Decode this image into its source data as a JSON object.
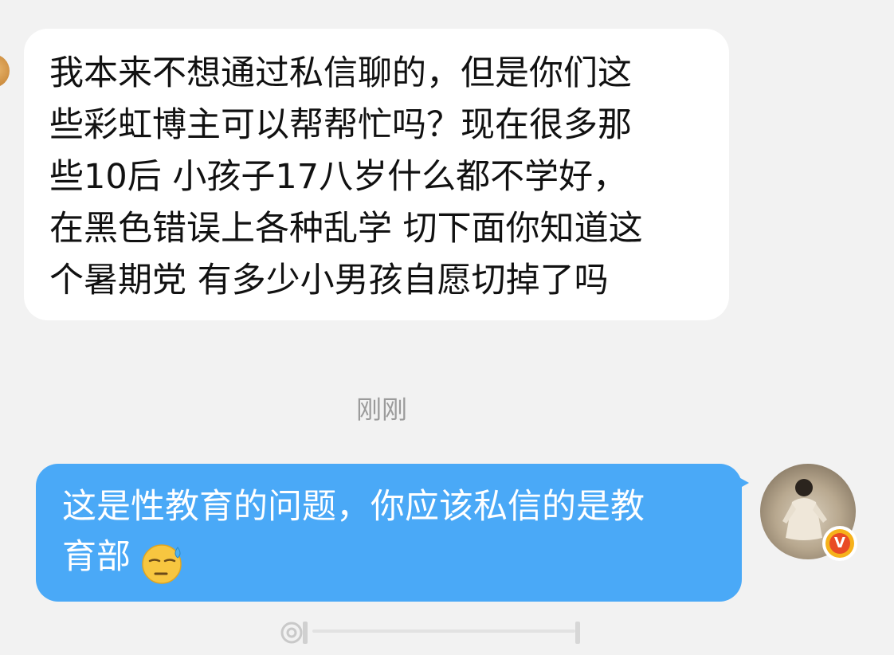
{
  "messages": {
    "incoming": {
      "text": "我本来不想通过私信聊的，但是你们这\n些彩虹博主可以帮帮忙吗？现在很多那\n些10后 小孩子17八岁什么都不学好，\n在黑色错误上各种乱学 切下面你知道这\n个暑期党 有多少小男孩自愿切掉了吗"
    },
    "timestamp": "刚刚",
    "outgoing": {
      "text": "这是性教育的问题，你应该私信的是教\n育部",
      "emoji": "downcast-face-with-sweat-icon"
    }
  },
  "badge": {
    "label": "V",
    "icon": "verified-v-icon"
  },
  "colors": {
    "background": "#f2f2f2",
    "incoming_bubble": "#ffffff",
    "outgoing_bubble": "#4aa9f7",
    "timestamp": "#9b9b9b",
    "badge_outer": "#f6b21b",
    "badge_inner": "#e94b25"
  }
}
